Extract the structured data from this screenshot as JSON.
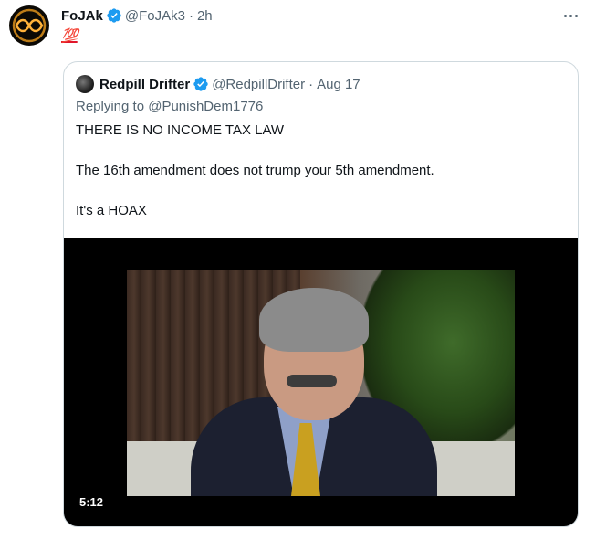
{
  "tweet": {
    "author_name": "FoJAk",
    "author_handle": "@FoJAk3",
    "separator": "·",
    "time": "2h",
    "body_emoji": "💯"
  },
  "quoted": {
    "author_name": "Redpill Drifter",
    "author_handle": "@RedpillDrifter",
    "separator": "·",
    "date": "Aug 17",
    "replying_prefix": "Replying to",
    "replying_to": "@PunishDem1776",
    "lines": [
      "THERE IS NO INCOME TAX LAW",
      "The 16th amendment does not trump your 5th amendment.",
      "It's a HOAX"
    ],
    "video_duration": "5:12"
  },
  "colors": {
    "text": "#0f1419",
    "secondary": "#536471",
    "verified": "#1d9bf0",
    "border": "#cfd9de",
    "hundred": "#e0162b"
  },
  "icons": [
    "avatar-image",
    "verified-badge-icon",
    "more-options-icon",
    "video-thumbnail"
  ]
}
